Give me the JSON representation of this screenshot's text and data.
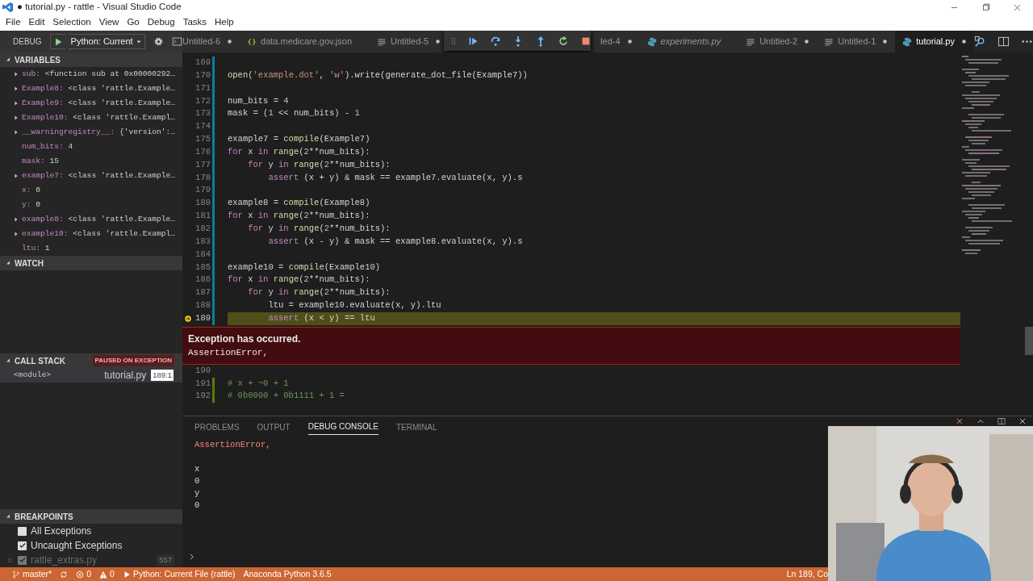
{
  "window": {
    "title": "● tutorial.py - rattle - Visual Studio Code"
  },
  "menu": [
    "File",
    "Edit",
    "Selection",
    "View",
    "Go",
    "Debug",
    "Tasks",
    "Help"
  ],
  "sidebar": {
    "toolbar": {
      "label": "DEBUG",
      "configuration": "Python: Current"
    },
    "variables": {
      "title": "VARIABLES",
      "expanded": true,
      "items": [
        {
          "name": "sub:",
          "value": "<function sub at 0x00000292…",
          "expandable": true
        },
        {
          "name": "Example8:",
          "value": "<class 'rattle.Example…",
          "expandable": true
        },
        {
          "name": "Example9:",
          "value": "<class 'rattle.Example…",
          "expandable": true
        },
        {
          "name": "Example10:",
          "value": "<class 'rattle.Exampl…",
          "expandable": true
        },
        {
          "name": "__warningregistry__:",
          "value": "{'version':…",
          "expandable": true
        },
        {
          "name": "num_bits:",
          "value": "4",
          "expandable": false
        },
        {
          "name": "mask:",
          "value": "15",
          "expandable": false
        },
        {
          "name": "example7:",
          "value": "<class 'rattle.Example…",
          "expandable": true
        },
        {
          "name": "x:",
          "value": "0",
          "expandable": false
        },
        {
          "name": "y:",
          "value": "0",
          "expandable": false
        },
        {
          "name": "example8:",
          "value": "<class 'rattle.Example…",
          "expandable": true
        },
        {
          "name": "example10:",
          "value": "<class 'rattle.Exampl…",
          "expandable": true
        },
        {
          "name": "ltu:",
          "value": "1",
          "expandable": false
        }
      ]
    },
    "watch": {
      "title": "WATCH",
      "expanded": true
    },
    "call_stack": {
      "title": "CALL STACK",
      "expanded": true,
      "badge": "PAUSED ON EXCEPTION",
      "frames": [
        {
          "name": "<module>",
          "file": "tutorial.py",
          "position": "189:1",
          "selected": true
        }
      ]
    },
    "breakpoints": {
      "title": "BREAKPOINTS",
      "expanded": true,
      "items": [
        {
          "kind": "exception",
          "label": "All Exceptions",
          "checked": false,
          "disabled": false
        },
        {
          "kind": "exception",
          "label": "Uncaught Exceptions",
          "checked": true,
          "disabled": false
        },
        {
          "kind": "file",
          "label": "rattle_extras.py",
          "line": "557",
          "checked": true,
          "disabled": true
        }
      ]
    }
  },
  "tabs": [
    {
      "kind": "plain",
      "label": "Untitled-6",
      "dirty": true,
      "selected": false,
      "preview": false,
      "partly_hidden": false
    },
    {
      "kind": "json",
      "label": "data.medicare.gov.json",
      "dirty": false,
      "selected": false,
      "preview": false,
      "partly_hidden": false
    },
    {
      "kind": "text",
      "label": "Untitled-5",
      "dirty": true,
      "selected": false,
      "preview": false,
      "partly_hidden": false
    },
    {
      "kind": "plain",
      "label": "led-4",
      "dirty": true,
      "selected": false,
      "preview": false,
      "partly_hidden": true
    },
    {
      "kind": "python",
      "label": "experiments.py",
      "dirty": false,
      "selected": false,
      "preview": true,
      "partly_hidden": false
    },
    {
      "kind": "text",
      "label": "Untitled-2",
      "dirty": true,
      "selected": false,
      "preview": false,
      "partly_hidden": false
    },
    {
      "kind": "text",
      "label": "Untitled-1",
      "dirty": true,
      "selected": false,
      "preview": false,
      "partly_hidden": false
    },
    {
      "kind": "python",
      "label": "tutorial.py",
      "dirty": true,
      "selected": true,
      "preview": false,
      "partly_hidden": false
    }
  ],
  "code": [
    {
      "number": "169",
      "kind": "modified",
      "current": false
    },
    {
      "number": "170",
      "kind": "modified",
      "current": false,
      "tokens": [
        {
          "kind": "fn",
          "text": "open"
        },
        {
          "kind": "txt",
          "text": "("
        },
        {
          "kind": "str",
          "text": "'example.dot'"
        },
        {
          "kind": "txt",
          "text": ", "
        },
        {
          "kind": "str",
          "text": "'w'"
        },
        {
          "kind": "txt",
          "text": ").write(generate_dot_file(Example7))"
        }
      ]
    },
    {
      "number": "171",
      "kind": "modified",
      "current": false
    },
    {
      "number": "172",
      "kind": "modified",
      "current": false,
      "tokens": [
        {
          "kind": "txt",
          "text": "num_bits = "
        },
        {
          "kind": "num",
          "text": "4"
        }
      ]
    },
    {
      "number": "173",
      "kind": "modified",
      "current": false,
      "tokens": [
        {
          "kind": "txt",
          "text": "mask = ("
        },
        {
          "kind": "num",
          "text": "1"
        },
        {
          "kind": "txt",
          "text": " << num_bits) - "
        },
        {
          "kind": "num",
          "text": "1"
        }
      ]
    },
    {
      "number": "174",
      "kind": "modified",
      "current": false
    },
    {
      "number": "175",
      "kind": "modified",
      "current": false,
      "tokens": [
        {
          "kind": "txt",
          "text": "example7 = "
        },
        {
          "kind": "fn",
          "text": "compile"
        },
        {
          "kind": "txt",
          "text": "(Example7)"
        }
      ]
    },
    {
      "number": "176",
      "kind": "modified",
      "current": false,
      "tokens": [
        {
          "kind": "kw",
          "text": "for"
        },
        {
          "kind": "txt",
          "text": " x "
        },
        {
          "kind": "kw",
          "text": "in"
        },
        {
          "kind": "fn",
          "text": " range"
        },
        {
          "kind": "txt",
          "text": "("
        },
        {
          "kind": "num",
          "text": "2"
        },
        {
          "kind": "txt",
          "text": "**num_bits):"
        }
      ]
    },
    {
      "number": "177",
      "kind": "modified",
      "current": false,
      "tokens": [
        {
          "kind": "kw",
          "text": "    for"
        },
        {
          "kind": "txt",
          "text": " y "
        },
        {
          "kind": "kw",
          "text": "in"
        },
        {
          "kind": "fn",
          "text": " range"
        },
        {
          "kind": "txt",
          "text": "("
        },
        {
          "kind": "num",
          "text": "2"
        },
        {
          "kind": "txt",
          "text": "**num_bits):"
        }
      ]
    },
    {
      "number": "178",
      "kind": "modified",
      "current": false,
      "tokens": [
        {
          "kind": "kw",
          "text": "        assert"
        },
        {
          "kind": "txt",
          "text": " (x + y) & mask == example7.evaluate(x, y).s"
        }
      ]
    },
    {
      "number": "179",
      "kind": "modified",
      "current": false
    },
    {
      "number": "180",
      "kind": "modified",
      "current": false,
      "tokens": [
        {
          "kind": "txt",
          "text": "example8 = "
        },
        {
          "kind": "fn",
          "text": "compile"
        },
        {
          "kind": "txt",
          "text": "(Example8)"
        }
      ]
    },
    {
      "number": "181",
      "kind": "modified",
      "current": false,
      "tokens": [
        {
          "kind": "kw",
          "text": "for"
        },
        {
          "kind": "txt",
          "text": " x "
        },
        {
          "kind": "kw",
          "text": "in"
        },
        {
          "kind": "fn",
          "text": " range"
        },
        {
          "kind": "txt",
          "text": "("
        },
        {
          "kind": "num",
          "text": "2"
        },
        {
          "kind": "txt",
          "text": "**num_bits):"
        }
      ]
    },
    {
      "number": "182",
      "kind": "modified",
      "current": false,
      "tokens": [
        {
          "kind": "kw",
          "text": "    for"
        },
        {
          "kind": "txt",
          "text": " y "
        },
        {
          "kind": "kw",
          "text": "in"
        },
        {
          "kind": "fn",
          "text": " range"
        },
        {
          "kind": "txt",
          "text": "("
        },
        {
          "kind": "num",
          "text": "2"
        },
        {
          "kind": "txt",
          "text": "**num_bits):"
        }
      ]
    },
    {
      "number": "183",
      "kind": "modified",
      "current": false,
      "tokens": [
        {
          "kind": "kw",
          "text": "        assert"
        },
        {
          "kind": "txt",
          "text": " (x - y) & mask == example8.evaluate(x, y).s"
        }
      ]
    },
    {
      "number": "184",
      "kind": "modified",
      "current": false
    },
    {
      "number": "185",
      "kind": "modified",
      "current": false,
      "tokens": [
        {
          "kind": "txt",
          "text": "example10 = "
        },
        {
          "kind": "fn",
          "text": "compile"
        },
        {
          "kind": "txt",
          "text": "(Example10)"
        }
      ]
    },
    {
      "number": "186",
      "kind": "modified",
      "current": false,
      "tokens": [
        {
          "kind": "kw",
          "text": "for"
        },
        {
          "kind": "txt",
          "text": " x "
        },
        {
          "kind": "kw",
          "text": "in"
        },
        {
          "kind": "fn",
          "text": " range"
        },
        {
          "kind": "txt",
          "text": "("
        },
        {
          "kind": "num",
          "text": "2"
        },
        {
          "kind": "txt",
          "text": "**num_bits):"
        }
      ]
    },
    {
      "number": "187",
      "kind": "modified",
      "current": false,
      "tokens": [
        {
          "kind": "kw",
          "text": "    for"
        },
        {
          "kind": "txt",
          "text": " y "
        },
        {
          "kind": "kw",
          "text": "in"
        },
        {
          "kind": "fn",
          "text": " range"
        },
        {
          "kind": "txt",
          "text": "("
        },
        {
          "kind": "num",
          "text": "2"
        },
        {
          "kind": "txt",
          "text": "**num_bits):"
        }
      ]
    },
    {
      "number": "188",
      "kind": "modified",
      "current": false,
      "tokens": [
        {
          "kind": "txt",
          "text": "        ltu = example10.evaluate(x, y).ltu"
        }
      ]
    },
    {
      "number": "189",
      "kind": "modified",
      "current": true,
      "tokens": [
        {
          "kind": "kw",
          "text": "        assert"
        },
        {
          "kind": "txt",
          "text": " (x < y) == ltu"
        }
      ],
      "exception": {
        "title": "Exception has occurred.",
        "message": "AssertionError,"
      }
    },
    {
      "number": "190",
      "kind": "unchanged",
      "current": false
    },
    {
      "number": "191",
      "kind": "added",
      "current": false,
      "tokens": [
        {
          "kind": "com",
          "text": "# x + ~0 + 1"
        }
      ]
    },
    {
      "number": "192",
      "kind": "added",
      "current": false,
      "tokens": [
        {
          "kind": "com",
          "text": "# 0b0000 + 0b1111 + 1 ="
        }
      ]
    }
  ],
  "panel": {
    "tabs": [
      {
        "label": "PROBLEMS",
        "selected": false
      },
      {
        "label": "OUTPUT",
        "selected": false
      },
      {
        "label": "DEBUG CONSOLE",
        "selected": true
      },
      {
        "label": "TERMINAL",
        "selected": false
      }
    ],
    "console": [
      {
        "kind": "error",
        "text": "AssertionError,"
      },
      {
        "kind": "blank"
      },
      {
        "kind": "output",
        "text": "x"
      },
      {
        "kind": "output",
        "text": "0"
      },
      {
        "kind": "output",
        "text": "y"
      },
      {
        "kind": "output",
        "text": "0"
      }
    ]
  },
  "status_bar": {
    "branch": "master*",
    "errors": "0",
    "warnings": "0",
    "launch": "Python: Current File (rattle)",
    "interpreter": "Anaconda Python 3.6.5",
    "position": "Ln 189, Co"
  }
}
